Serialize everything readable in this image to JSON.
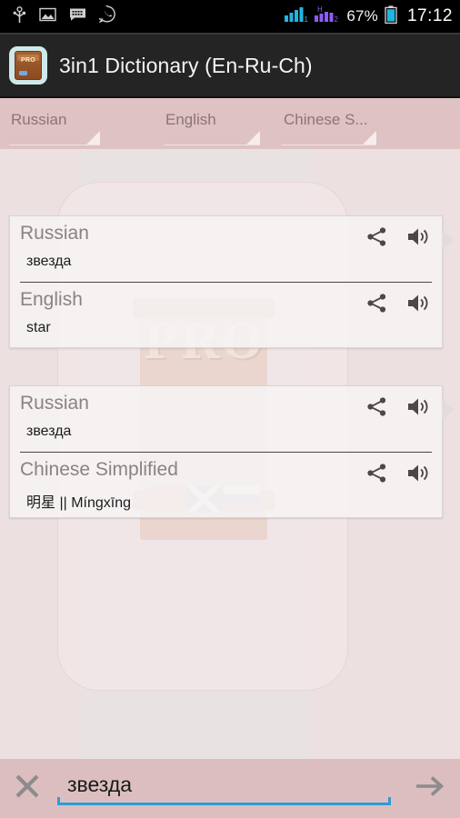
{
  "status_bar": {
    "icons": [
      "usb-icon",
      "image-icon",
      "sms-icon",
      "whatsapp-icon"
    ],
    "signal_icons": [
      "signal-1-icon",
      "signal-h2-icon"
    ],
    "battery_percent": "67%",
    "battery_icon": "battery-icon",
    "time": "17:12"
  },
  "title_bar": {
    "app_icon": "dictionary-book-icon",
    "app_icon_badge": "PRO",
    "title": "3in1 Dictionary (En-Ru-Ch)"
  },
  "language_bar": {
    "source": {
      "value": "Russian",
      "dropdown_icon": "dropdown-triangle-icon"
    },
    "middle": {
      "value": "English",
      "dropdown_icon": "dropdown-triangle-icon"
    },
    "target": {
      "value": "Chinese S...",
      "dropdown_icon": "dropdown-triangle-icon"
    },
    "swap_button": {
      "icon": "double-chevron-right-icon",
      "label": ">>"
    }
  },
  "watermark": {
    "text": "PRO",
    "flags": [
      "china-flag",
      "uk-flag",
      "russia-flag"
    ]
  },
  "results": {
    "cards": [
      {
        "entries": [
          {
            "language": "Russian",
            "word": "звезда",
            "share_icon": "share-icon",
            "speak_icon": "speaker-icon"
          },
          {
            "language": "English",
            "word": "star",
            "share_icon": "share-icon",
            "speak_icon": "speaker-icon"
          }
        ]
      },
      {
        "entries": [
          {
            "language": "Russian",
            "word": "звезда",
            "share_icon": "share-icon",
            "speak_icon": "speaker-icon"
          },
          {
            "language": "Chinese Simplified",
            "word": "明星 || Míngxīng",
            "share_icon": "share-icon",
            "speak_icon": "speaker-icon"
          }
        ]
      }
    ]
  },
  "search_bar": {
    "clear_icon": "close-x-icon",
    "input_value": "звезда",
    "input_placeholder": "",
    "submit_icon": "arrow-right-icon",
    "underline_color": "#2e9bd6"
  },
  "colors": {
    "status_bar_bg": "#000000",
    "title_bar_bg": "#242424",
    "lang_bar_bg": "#dfc2c3",
    "content_bg": "#ece0e0",
    "search_bar_bg": "#dcbec0",
    "card_bg": "#f6f3f3",
    "accent": "#2e9bd6"
  }
}
